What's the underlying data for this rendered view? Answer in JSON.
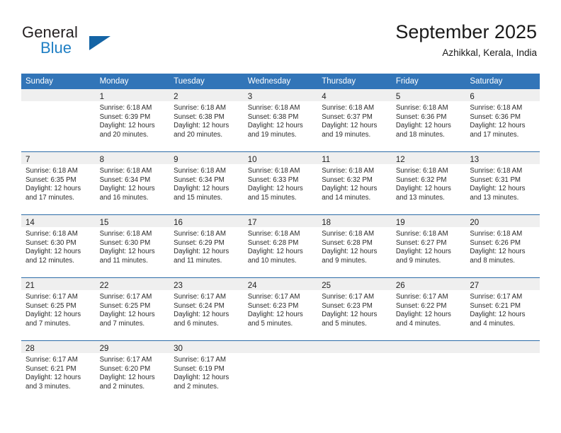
{
  "brand": {
    "name_part1": "General",
    "name_part2": "Blue",
    "accent_color": "#1f7fc4",
    "triangle_color": "#1464a5"
  },
  "header": {
    "month_title": "September 2025",
    "location": "Azhikkal, Kerala, India"
  },
  "calendar": {
    "header_bg": "#3275b8",
    "daynum_band_bg": "#efefef",
    "row_separator_color": "#2d6ca8",
    "weekday_headers": [
      "Sunday",
      "Monday",
      "Tuesday",
      "Wednesday",
      "Thursday",
      "Friday",
      "Saturday"
    ],
    "weeks": [
      [
        {
          "day": "",
          "lines": []
        },
        {
          "day": "1",
          "lines": [
            "Sunrise: 6:18 AM",
            "Sunset: 6:39 PM",
            "Daylight: 12 hours",
            "and 20 minutes."
          ]
        },
        {
          "day": "2",
          "lines": [
            "Sunrise: 6:18 AM",
            "Sunset: 6:38 PM",
            "Daylight: 12 hours",
            "and 20 minutes."
          ]
        },
        {
          "day": "3",
          "lines": [
            "Sunrise: 6:18 AM",
            "Sunset: 6:38 PM",
            "Daylight: 12 hours",
            "and 19 minutes."
          ]
        },
        {
          "day": "4",
          "lines": [
            "Sunrise: 6:18 AM",
            "Sunset: 6:37 PM",
            "Daylight: 12 hours",
            "and 19 minutes."
          ]
        },
        {
          "day": "5",
          "lines": [
            "Sunrise: 6:18 AM",
            "Sunset: 6:36 PM",
            "Daylight: 12 hours",
            "and 18 minutes."
          ]
        },
        {
          "day": "6",
          "lines": [
            "Sunrise: 6:18 AM",
            "Sunset: 6:36 PM",
            "Daylight: 12 hours",
            "and 17 minutes."
          ]
        }
      ],
      [
        {
          "day": "7",
          "lines": [
            "Sunrise: 6:18 AM",
            "Sunset: 6:35 PM",
            "Daylight: 12 hours",
            "and 17 minutes."
          ]
        },
        {
          "day": "8",
          "lines": [
            "Sunrise: 6:18 AM",
            "Sunset: 6:34 PM",
            "Daylight: 12 hours",
            "and 16 minutes."
          ]
        },
        {
          "day": "9",
          "lines": [
            "Sunrise: 6:18 AM",
            "Sunset: 6:34 PM",
            "Daylight: 12 hours",
            "and 15 minutes."
          ]
        },
        {
          "day": "10",
          "lines": [
            "Sunrise: 6:18 AM",
            "Sunset: 6:33 PM",
            "Daylight: 12 hours",
            "and 15 minutes."
          ]
        },
        {
          "day": "11",
          "lines": [
            "Sunrise: 6:18 AM",
            "Sunset: 6:32 PM",
            "Daylight: 12 hours",
            "and 14 minutes."
          ]
        },
        {
          "day": "12",
          "lines": [
            "Sunrise: 6:18 AM",
            "Sunset: 6:32 PM",
            "Daylight: 12 hours",
            "and 13 minutes."
          ]
        },
        {
          "day": "13",
          "lines": [
            "Sunrise: 6:18 AM",
            "Sunset: 6:31 PM",
            "Daylight: 12 hours",
            "and 13 minutes."
          ]
        }
      ],
      [
        {
          "day": "14",
          "lines": [
            "Sunrise: 6:18 AM",
            "Sunset: 6:30 PM",
            "Daylight: 12 hours",
            "and 12 minutes."
          ]
        },
        {
          "day": "15",
          "lines": [
            "Sunrise: 6:18 AM",
            "Sunset: 6:30 PM",
            "Daylight: 12 hours",
            "and 11 minutes."
          ]
        },
        {
          "day": "16",
          "lines": [
            "Sunrise: 6:18 AM",
            "Sunset: 6:29 PM",
            "Daylight: 12 hours",
            "and 11 minutes."
          ]
        },
        {
          "day": "17",
          "lines": [
            "Sunrise: 6:18 AM",
            "Sunset: 6:28 PM",
            "Daylight: 12 hours",
            "and 10 minutes."
          ]
        },
        {
          "day": "18",
          "lines": [
            "Sunrise: 6:18 AM",
            "Sunset: 6:28 PM",
            "Daylight: 12 hours",
            "and 9 minutes."
          ]
        },
        {
          "day": "19",
          "lines": [
            "Sunrise: 6:18 AM",
            "Sunset: 6:27 PM",
            "Daylight: 12 hours",
            "and 9 minutes."
          ]
        },
        {
          "day": "20",
          "lines": [
            "Sunrise: 6:18 AM",
            "Sunset: 6:26 PM",
            "Daylight: 12 hours",
            "and 8 minutes."
          ]
        }
      ],
      [
        {
          "day": "21",
          "lines": [
            "Sunrise: 6:17 AM",
            "Sunset: 6:25 PM",
            "Daylight: 12 hours",
            "and 7 minutes."
          ]
        },
        {
          "day": "22",
          "lines": [
            "Sunrise: 6:17 AM",
            "Sunset: 6:25 PM",
            "Daylight: 12 hours",
            "and 7 minutes."
          ]
        },
        {
          "day": "23",
          "lines": [
            "Sunrise: 6:17 AM",
            "Sunset: 6:24 PM",
            "Daylight: 12 hours",
            "and 6 minutes."
          ]
        },
        {
          "day": "24",
          "lines": [
            "Sunrise: 6:17 AM",
            "Sunset: 6:23 PM",
            "Daylight: 12 hours",
            "and 5 minutes."
          ]
        },
        {
          "day": "25",
          "lines": [
            "Sunrise: 6:17 AM",
            "Sunset: 6:23 PM",
            "Daylight: 12 hours",
            "and 5 minutes."
          ]
        },
        {
          "day": "26",
          "lines": [
            "Sunrise: 6:17 AM",
            "Sunset: 6:22 PM",
            "Daylight: 12 hours",
            "and 4 minutes."
          ]
        },
        {
          "day": "27",
          "lines": [
            "Sunrise: 6:17 AM",
            "Sunset: 6:21 PM",
            "Daylight: 12 hours",
            "and 4 minutes."
          ]
        }
      ],
      [
        {
          "day": "28",
          "lines": [
            "Sunrise: 6:17 AM",
            "Sunset: 6:21 PM",
            "Daylight: 12 hours",
            "and 3 minutes."
          ]
        },
        {
          "day": "29",
          "lines": [
            "Sunrise: 6:17 AM",
            "Sunset: 6:20 PM",
            "Daylight: 12 hours",
            "and 2 minutes."
          ]
        },
        {
          "day": "30",
          "lines": [
            "Sunrise: 6:17 AM",
            "Sunset: 6:19 PM",
            "Daylight: 12 hours",
            "and 2 minutes."
          ]
        },
        {
          "day": "",
          "lines": []
        },
        {
          "day": "",
          "lines": []
        },
        {
          "day": "",
          "lines": []
        },
        {
          "day": "",
          "lines": []
        }
      ]
    ]
  }
}
